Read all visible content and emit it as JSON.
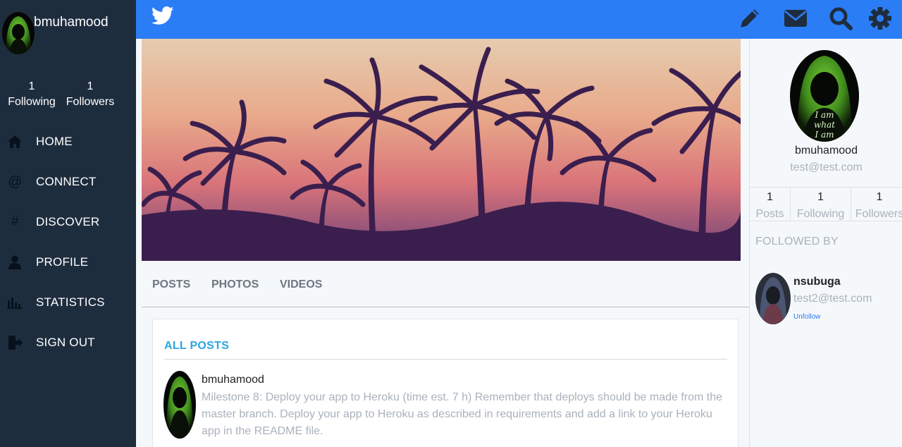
{
  "colors": {
    "sidebar": "#1e2d3e",
    "topbar": "#2b7df6",
    "accent": "#2aa5df",
    "muted_text": "#a9b2bb"
  },
  "sidebar": {
    "username": "bmuhamood",
    "stats": {
      "following_count": "1",
      "following_label": "Following",
      "followers_count": "1",
      "followers_label": "Followers"
    },
    "nav": [
      {
        "label": "HOME",
        "icon": "home-icon"
      },
      {
        "label": "CONNECT",
        "icon": "at-icon"
      },
      {
        "label": "DISCOVER",
        "icon": "hashtag-icon"
      },
      {
        "label": "PROFILE",
        "icon": "user-icon"
      },
      {
        "label": "STATISTICS",
        "icon": "bar-chart-icon"
      },
      {
        "label": "SIGN OUT",
        "icon": "sign-out-icon"
      }
    ]
  },
  "topbar": {
    "logo_icon": "twitter-logo-icon",
    "actions": [
      "pencil-icon",
      "envelope-icon",
      "search-icon",
      "gear-icon"
    ]
  },
  "tabs": [
    "POSTS",
    "PHOTOS",
    "VIDEOS"
  ],
  "posts_card": {
    "title": "ALL POSTS",
    "post": {
      "username": "bmuhamood",
      "text": "Milestone 8: Deploy your app to Heroku (time est. 7 h) Remember that deploys should be made from the master branch. Deploy your app to Heroku as described in requirements and add a link to your Heroku app in the README file."
    }
  },
  "right_panel": {
    "avatar_caption": [
      "I am",
      "what",
      "I am"
    ],
    "name": "bmuhamood",
    "email": "test@test.com",
    "stats": [
      {
        "count": "1",
        "label": "Posts"
      },
      {
        "count": "1",
        "label": "Following"
      },
      {
        "count": "1",
        "label": "Followers"
      }
    ],
    "followed_by_heading": "FOLLOWED BY",
    "followed_by": {
      "name": "nsubuga",
      "email": "test2@test.com",
      "action": "Unfollow"
    }
  }
}
